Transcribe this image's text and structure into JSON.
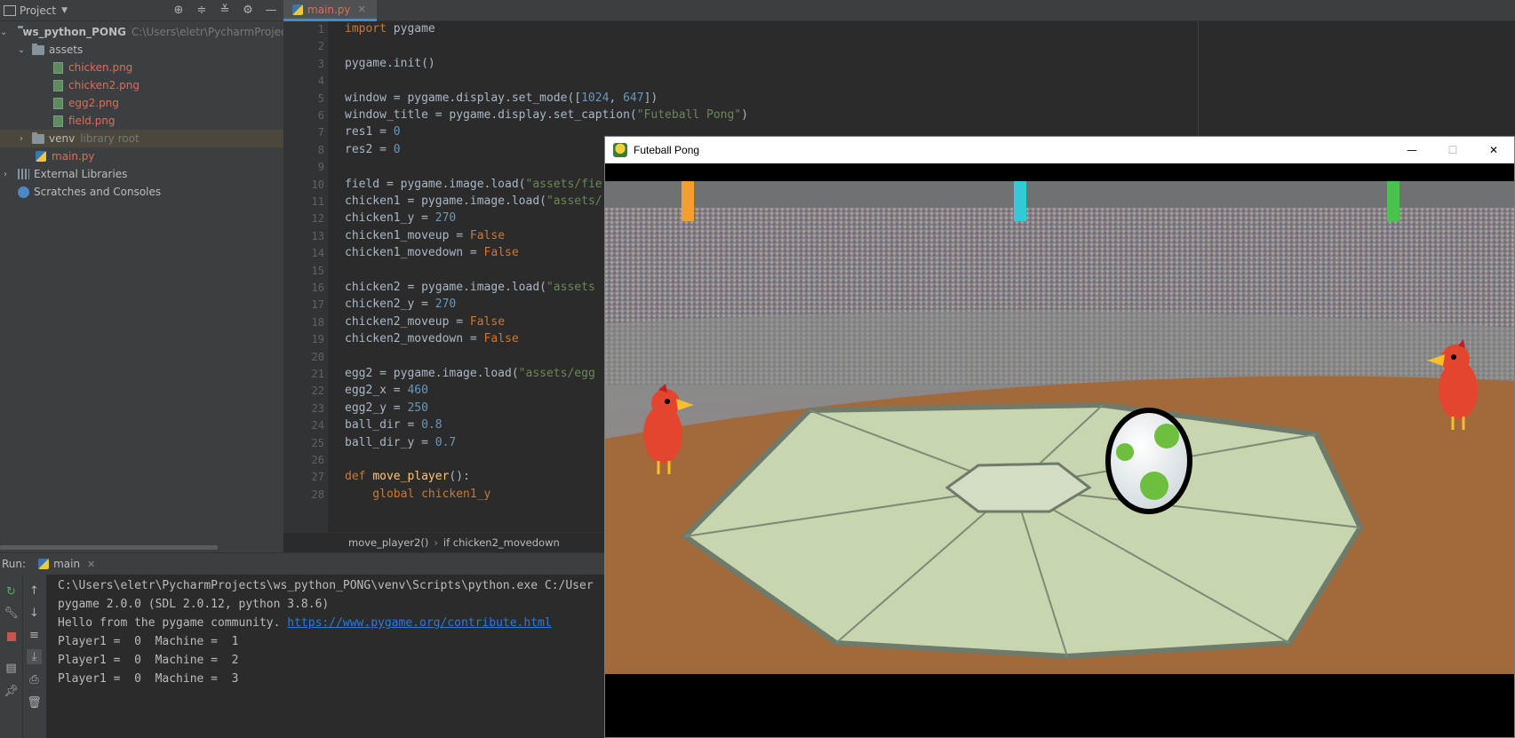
{
  "project_panel": {
    "title": "Project",
    "tree": [
      {
        "label": "ws_python_PONG",
        "extra": "C:\\Users\\eletr\\PycharmProjects\\w"
      },
      {
        "label": "assets"
      },
      {
        "label": "chicken.png"
      },
      {
        "label": "chicken2.png"
      },
      {
        "label": "egg2.png"
      },
      {
        "label": "field.png"
      },
      {
        "label": "venv",
        "extra": "library root"
      },
      {
        "label": "main.py"
      },
      {
        "label": "External Libraries"
      },
      {
        "label": "Scratches and Consoles"
      }
    ]
  },
  "editor": {
    "tab_label": "main.py",
    "line_numbers": [
      "1",
      "2",
      "3",
      "4",
      "5",
      "6",
      "7",
      "8",
      "9",
      "10",
      "11",
      "12",
      "13",
      "14",
      "15",
      "16",
      "17",
      "18",
      "19",
      "20",
      "21",
      "22",
      "23",
      "24",
      "25",
      "26",
      "27",
      "28"
    ],
    "code": {
      "l1_kw": "import",
      "l1_rest": " pygame",
      "l3": "pygame.init()",
      "l5_a": "window = pygame.display.set_mode([",
      "l5_n1": "1024",
      "l5_b": ", ",
      "l5_n2": "647",
      "l5_c": "])",
      "l6_a": "window_title = pygame.display.set_caption(",
      "l6_s": "\"Futeball Pong\"",
      "l6_c": ")",
      "l7_a": "res1 = ",
      "l7_n": "0",
      "l8_a": "res2 = ",
      "l8_n": "0",
      "l10_a": "field = pygame.image.load(",
      "l10_s": "\"assets/fie",
      "l11_a": "chicken1 = pygame.image.load(",
      "l11_s": "\"assets/",
      "l12_a": "chicken1_y = ",
      "l12_n": "270",
      "l13_a": "chicken1_moveup = ",
      "l13_k": "False",
      "l14_a": "chicken1_movedown = ",
      "l14_k": "False",
      "l16_a": "chicken2 = pygame.image.load(",
      "l16_s": "\"assets",
      "l17_a": "chicken2_y = ",
      "l17_n": "270",
      "l18_a": "chicken2_moveup = ",
      "l18_k": "False",
      "l19_a": "chicken2_movedown = ",
      "l19_k": "False",
      "l21_a": "egg2 = pygame.image.load(",
      "l21_s": "\"assets/egg",
      "l22_a": "egg2_x = ",
      "l22_n": "460",
      "l23_a": "egg2_y = ",
      "l23_n": "250",
      "l24_a": "ball_dir = ",
      "l24_n": "0.8",
      "l25_a": "ball_dir_y = ",
      "l25_n": "0.7",
      "l27_k": "def ",
      "l27_f": "move_player",
      "l27_c": "():",
      "l28": "    global chicken1_y"
    },
    "breadcrumb": [
      "move_player2()",
      "if chicken2_movedown"
    ]
  },
  "run_panel": {
    "label": "Run:",
    "tab_label": "main",
    "console": [
      "C:\\Users\\eletr\\PycharmProjects\\ws_python_PONG\\venv\\Scripts\\python.exe C:/User",
      "pygame 2.0.0 (SDL 2.0.12, python 3.8.6)",
      "Hello from the pygame community. ",
      "Player1 =  0  Machine =  1",
      "Player1 =  0  Machine =  2",
      "Player1 =  0  Machine =  3"
    ],
    "console_link": "https://www.pygame.org/contribute.html"
  },
  "game_window": {
    "title": "Futeball Pong",
    "minimize": "—",
    "maximize": "☐",
    "close": "✕"
  },
  "colors": {
    "accent": "#4a88c7",
    "modified_file": "#e06c57",
    "keyword": "#cc7832",
    "number": "#6897bb",
    "string": "#6a8759"
  },
  "icons": [
    "project-window-icon",
    "chevron-down-icon",
    "locate-icon",
    "expand-all-icon",
    "collapse-all-icon",
    "gear-icon",
    "minimize-icon",
    "folder-icon",
    "image-file-icon",
    "python-file-icon",
    "library-icon",
    "scratches-icon",
    "rerun-icon",
    "wrench-icon",
    "stop-icon",
    "layout-icon",
    "pin-icon",
    "arrow-up-icon",
    "arrow-down-icon",
    "soft-wrap-icon",
    "scroll-end-icon",
    "print-icon",
    "trash-icon",
    "pygame-icon"
  ]
}
